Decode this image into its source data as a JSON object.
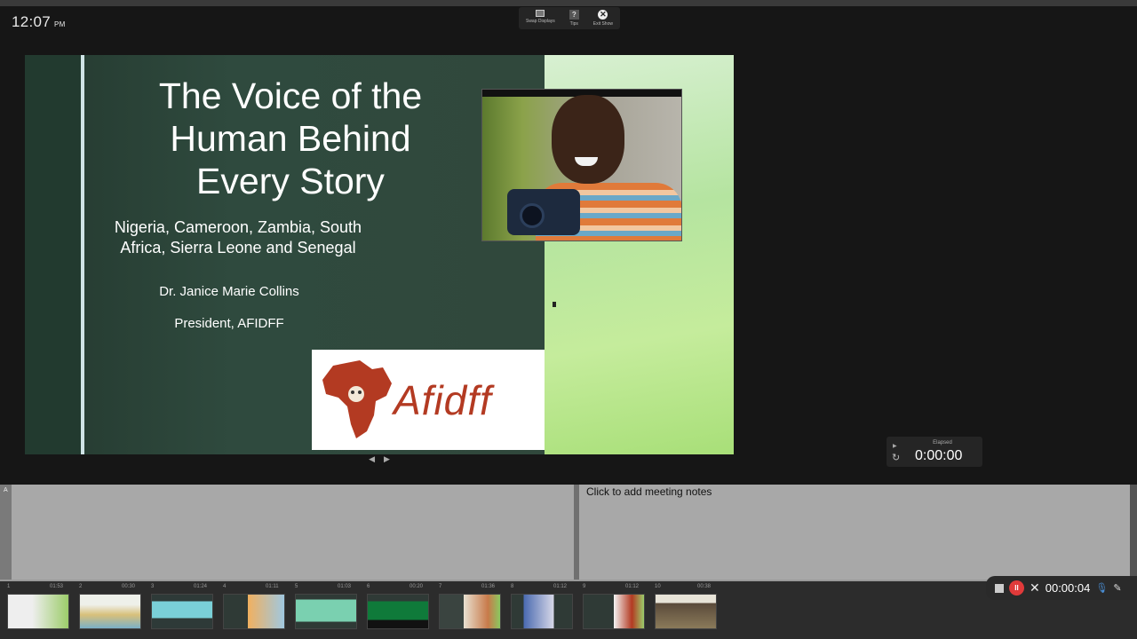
{
  "clock": {
    "time": "12:07",
    "ampm": "PM"
  },
  "toolbar": {
    "swap_label": "Swap Displays",
    "tips_label": "Tips",
    "exit_label": "Exit Show",
    "tips_glyph": "?",
    "exit_glyph": "✕"
  },
  "slide": {
    "title": "The Voice of the Human Behind Every Story",
    "subtitle": "Nigeria, Cameroon, Zambia, South Africa, Sierra Leone and Senegal",
    "author": "Dr. Janice Marie Collins",
    "role": "President, AFIDFF",
    "logo_text": "Afidff",
    "colors": {
      "dark_green": "#2d4438",
      "light_green": "#b5e4a0",
      "logo_red": "#b33a22"
    }
  },
  "slide_controls": {
    "prev": "◀",
    "next": "▶"
  },
  "timer": {
    "label": "Elapsed",
    "value": "0:00:00",
    "reset_glyph": "↻",
    "play_glyph": "▶"
  },
  "notes": {
    "margin_label": "A",
    "placeholder": "Click to add meeting notes"
  },
  "thumbnails": [
    {
      "number": "1",
      "time": "01:53"
    },
    {
      "number": "2",
      "time": "00:30"
    },
    {
      "number": "3",
      "time": "01:24"
    },
    {
      "number": "4",
      "time": "01:11"
    },
    {
      "number": "5",
      "time": "01:03"
    },
    {
      "number": "6",
      "time": "00:20"
    },
    {
      "number": "7",
      "time": "01:36"
    },
    {
      "number": "8",
      "time": "01:12"
    },
    {
      "number": "9",
      "time": "01:12"
    },
    {
      "number": "10",
      "time": "00:38"
    }
  ],
  "recording": {
    "elapsed": "00:00:04",
    "pause_glyph": "II",
    "close_glyph": "✕",
    "mic_glyph": "🎙",
    "pen_glyph": "✎"
  },
  "icons": [
    "swap-displays-icon",
    "tips-icon",
    "exit-icon",
    "reset-icon",
    "stop-icon",
    "pause-icon",
    "close-icon",
    "mic-icon",
    "pen-icon"
  ]
}
